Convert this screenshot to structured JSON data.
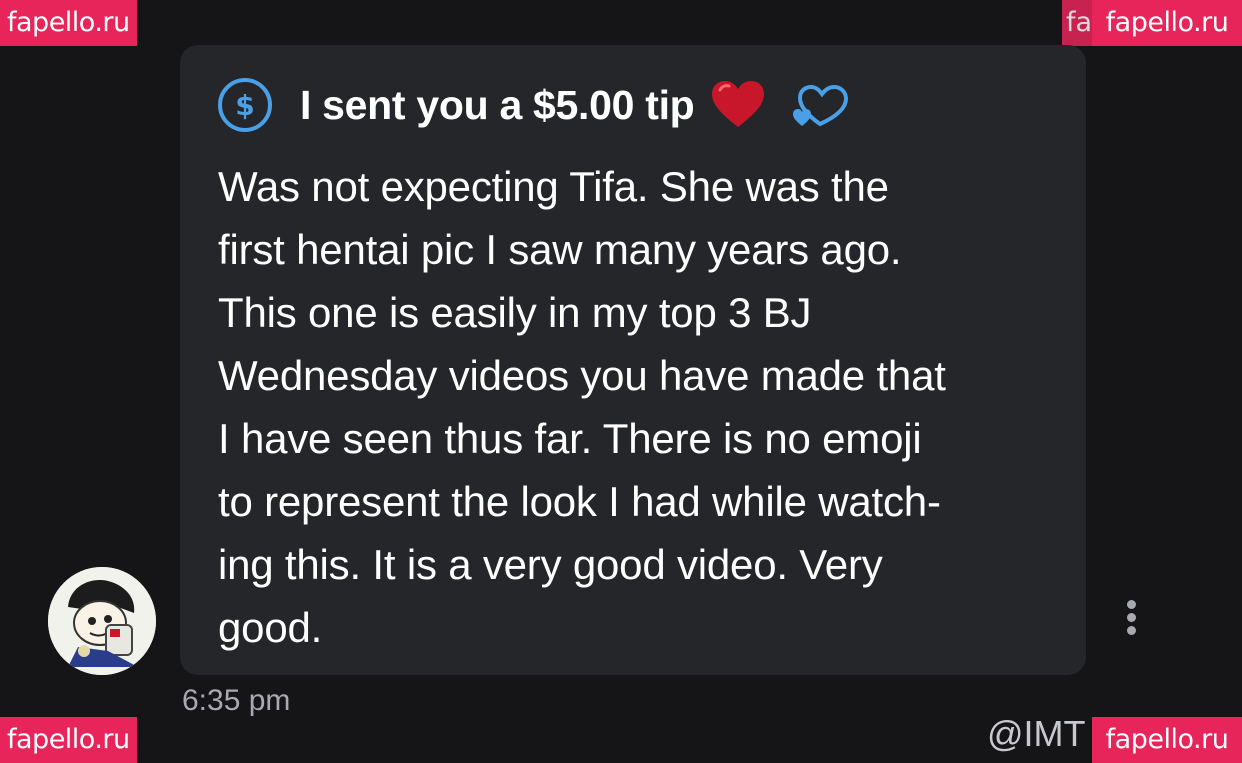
{
  "watermarks": {
    "top_left": "fapello.ru",
    "top_right": "fapello.ru",
    "top_right_ghost": "fa",
    "bottom_left": "fapello.ru",
    "bottom_right": "fapello.ru"
  },
  "message": {
    "tip_text": "I sent you a $5.00 tip",
    "dollar_symbol": "$",
    "lines": [
      "Was not expecting Tifa. She was the",
      "first hentai pic I saw many years ago.",
      "This one is easily in my top 3 BJ",
      "Wednesday videos you have made that",
      "I have seen thus far. There is no emoji",
      "to represent the look I had while watch-",
      "ing this. It is a very good video. Very",
      "good."
    ],
    "time": "6:35 pm"
  },
  "handle": "@IMT",
  "icons": {
    "tip": "dollar-circle-icon",
    "heart": "red-heart-icon",
    "hearts": "blue-hearts-icon",
    "more": "more-vertical-icon"
  },
  "colors": {
    "background": "#151518",
    "bubble": "#252629",
    "accent_blue": "#4aa0e6",
    "heart_red": "#c8162a",
    "watermark": "#e8255a",
    "muted_text": "#a8aab0"
  }
}
